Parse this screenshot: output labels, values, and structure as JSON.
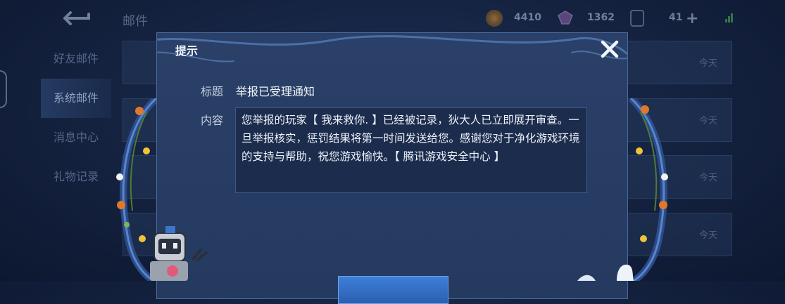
{
  "header": {
    "title": "邮件",
    "coins": "4410",
    "gems": "1362",
    "tickets": "41"
  },
  "sidebar": {
    "items": [
      {
        "label": "好友邮件"
      },
      {
        "label": "系统邮件"
      },
      {
        "label": "消息中心"
      },
      {
        "label": "礼物记录"
      }
    ]
  },
  "list": {
    "dates": [
      "今天",
      "今天",
      "今天",
      "今天"
    ]
  },
  "dialog": {
    "title": "提示",
    "subject_label": "标题",
    "subject": "举报已受理通知",
    "content_label": "内容",
    "content": "您举报的玩家【 我来救你. 】已经被记录，狄大人已立即展开审查。一旦举报核实，惩罚结果将第一时间发送给您。感谢您对于净化游戏环境的支持与帮助，祝您游戏愉快。【 腾讯游戏安全中心 】"
  },
  "colors": {
    "accent": "#3d7fd8",
    "dialog_bg": "#2a4068",
    "page_bg": "#14223f"
  }
}
